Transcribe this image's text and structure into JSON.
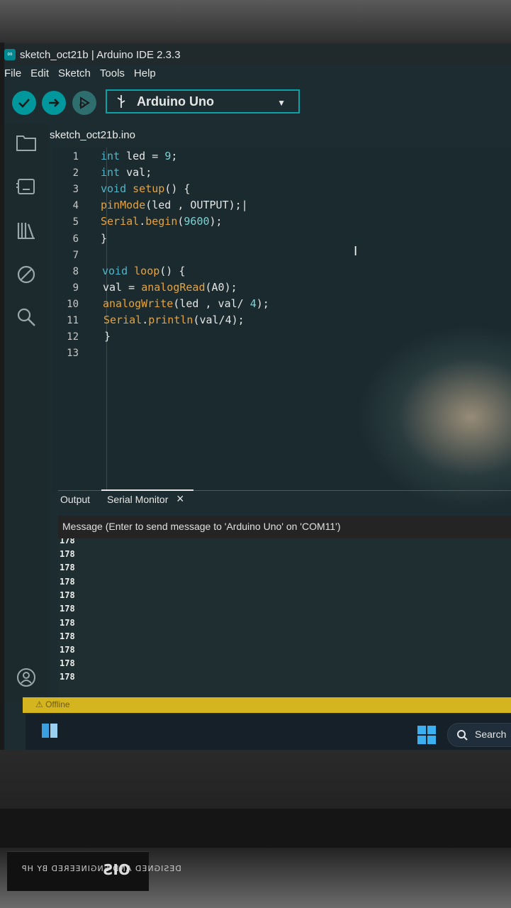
{
  "window": {
    "title": "sketch_oct21b | Arduino IDE 2.3.3"
  },
  "menu": [
    "File",
    "Edit",
    "Sketch",
    "Tools",
    "Help"
  ],
  "toolbar": {
    "board": "Arduino Uno"
  },
  "editor": {
    "file_tab": "sketch_oct21b.ino",
    "line_numbers": [
      "1",
      "2",
      "3",
      "4",
      "5",
      "6",
      "7",
      "8",
      "9",
      "10",
      "11",
      "12",
      "13"
    ]
  },
  "panel": {
    "tab_output": "Output",
    "tab_serial": "Serial Monitor",
    "close_glyph": "×",
    "message_placeholder": "Message (Enter to send message to 'Arduino Uno' on 'COM11')",
    "serial_lines": [
      "178",
      "178",
      "178",
      "178",
      "178",
      "178",
      "178",
      "178",
      "178",
      "178"
    ]
  },
  "status": {
    "text": "⚠ Offline"
  },
  "taskbar": {
    "search": "Search"
  },
  "bezel": {
    "brand": "DESIGNED AND ENGINEERED BY HP",
    "model": "OIS"
  },
  "colors": {
    "accent": "#00979d",
    "status_bar": "#d4b41f"
  }
}
